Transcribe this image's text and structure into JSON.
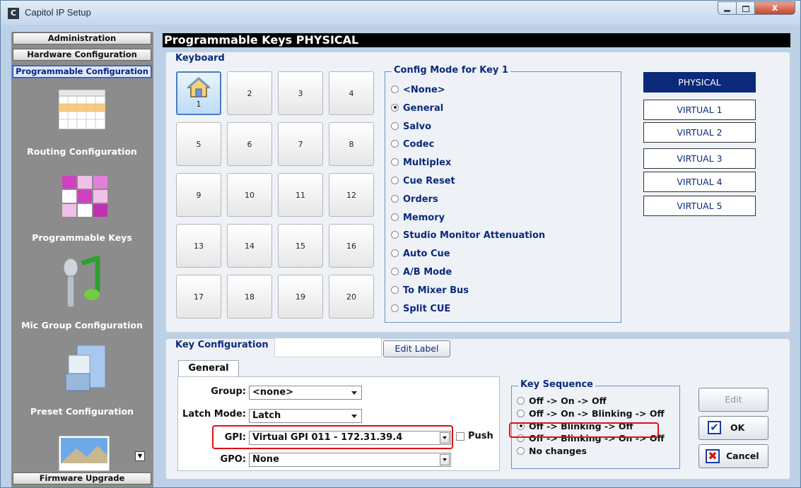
{
  "window": {
    "title": "Capitol IP Setup",
    "app_icon_letter": "C",
    "close_glyph": "x"
  },
  "sidebar": {
    "nav_top": [
      "Administration",
      "Hardware Configuration",
      "Programmable Configuration"
    ],
    "sections": [
      {
        "label": "Routing Configuration",
        "icon": "calendar-grid-icon"
      },
      {
        "label": "Programmable Keys",
        "icon": "colored-grid-icon"
      },
      {
        "label": "Mic Group Configuration",
        "icon": "microphone-note-icon"
      },
      {
        "label": "Preset Configuration",
        "icon": "folder-documents-icon"
      }
    ],
    "bottom_button": "Firmware Upgrade"
  },
  "main": {
    "header": "Programmable Keys PHYSICAL",
    "keyboard": {
      "title": "Keyboard",
      "keys": [
        "1",
        "2",
        "3",
        "4",
        "5",
        "6",
        "7",
        "8",
        "9",
        "10",
        "11",
        "12",
        "13",
        "14",
        "15",
        "16",
        "17",
        "18",
        "19",
        "20"
      ],
      "selected_key": "1"
    },
    "config_mode": {
      "title": "Config Mode for Key 1",
      "options": [
        "<None>",
        "General",
        "Salvo",
        "Codec",
        "Multiplex",
        "Cue Reset",
        "Orders",
        "Memory",
        "Studio Monitor Attenuation",
        "Auto Cue",
        "A/B Mode",
        "To Mixer Bus",
        "Split CUE"
      ],
      "selected": "General"
    },
    "modes": [
      "PHYSICAL",
      "VIRTUAL 1",
      "VIRTUAL 2",
      "VIRTUAL 3",
      "VIRTUAL 4",
      "VIRTUAL 5"
    ],
    "active_mode": "PHYSICAL",
    "key_configuration": {
      "title": "Key Configuration",
      "label_value": "",
      "edit_label_button": "Edit Label",
      "tab": "General",
      "group_label": "Group:",
      "group_value": "<none>",
      "latch_label": "Latch Mode:",
      "latch_value": "Latch",
      "gpi_label": "GPI:",
      "gpi_value": "Virtual GPI 011 - 172.31.39.4",
      "push_label": "Push",
      "gpo_label": "GPO:",
      "gpo_value": "None"
    },
    "key_sequence": {
      "title": "Key Sequence",
      "options": [
        "Off -> On -> Off",
        "Off -> On -> Blinking -> Off",
        "Off -> Blinking -> Off",
        "Off -> Blinking -> On -> Off",
        "No changes"
      ],
      "selected": "Off -> Blinking -> Off"
    },
    "buttons": {
      "edit": "Edit",
      "ok": "OK",
      "cancel": "Cancel"
    }
  },
  "colors": {
    "accent": "#0b2a7a",
    "highlight": "#e01010"
  }
}
